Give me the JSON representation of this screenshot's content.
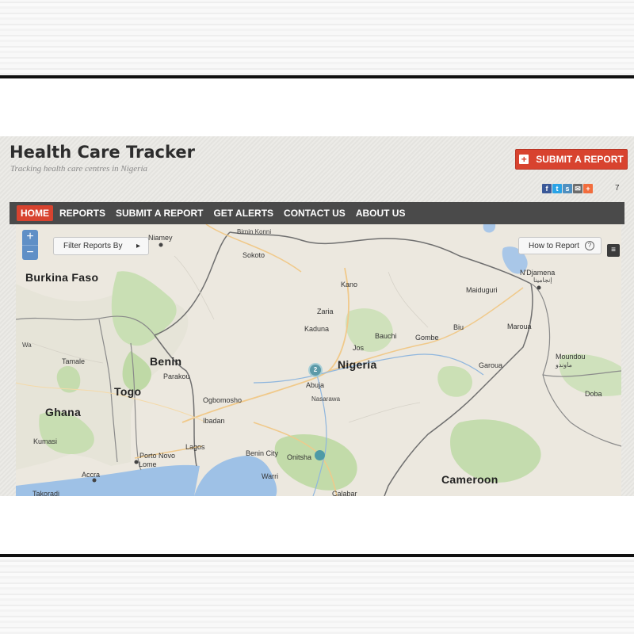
{
  "site": {
    "title": "Health Care Tracker",
    "tagline": "Tracking health care centres in Nigeria",
    "submit_button": "SUBMIT A REPORT",
    "share_count": "7",
    "share_icons": [
      "facebook-icon",
      "twitter-icon",
      "stumbleupon-icon",
      "email-icon",
      "plus-icon"
    ],
    "accent_color": "#d8432f"
  },
  "nav": {
    "items": [
      "HOME",
      "REPORTS",
      "SUBMIT A REPORT",
      "GET ALERTS",
      "CONTACT US",
      "ABOUT US"
    ],
    "active": "HOME"
  },
  "map": {
    "zoom_in": "+",
    "zoom_out": "−",
    "filter_button": "Filter Reports By",
    "how_button": "How to Report",
    "cluster_count": "2",
    "countries": [
      "Burkina Faso",
      "Benin",
      "Togo",
      "Ghana",
      "Nigeria",
      "Cameroon"
    ],
    "cities": [
      "Niamey",
      "Birnin Konni",
      "Sokoto",
      "Kano",
      "Zaria",
      "Kaduna",
      "Maiduguri",
      "N'Djamena",
      "Bauchi",
      "Gombe",
      "Biu",
      "Maroua",
      "Jos",
      "Garoua",
      "Moundou",
      "Doba",
      "Abuja",
      "Nasarawa",
      "Tamale",
      "Parakou",
      "Ogbomosho",
      "Ibadan",
      "Lagos",
      "Porto Novo",
      "Lome",
      "Kumasi",
      "Accra",
      "Takoradi",
      "Benin City",
      "Onitsha",
      "Warri",
      "Calabar",
      "Wa"
    ],
    "arabic_labels": [
      "إنجامينا",
      "ماوندو"
    ]
  }
}
